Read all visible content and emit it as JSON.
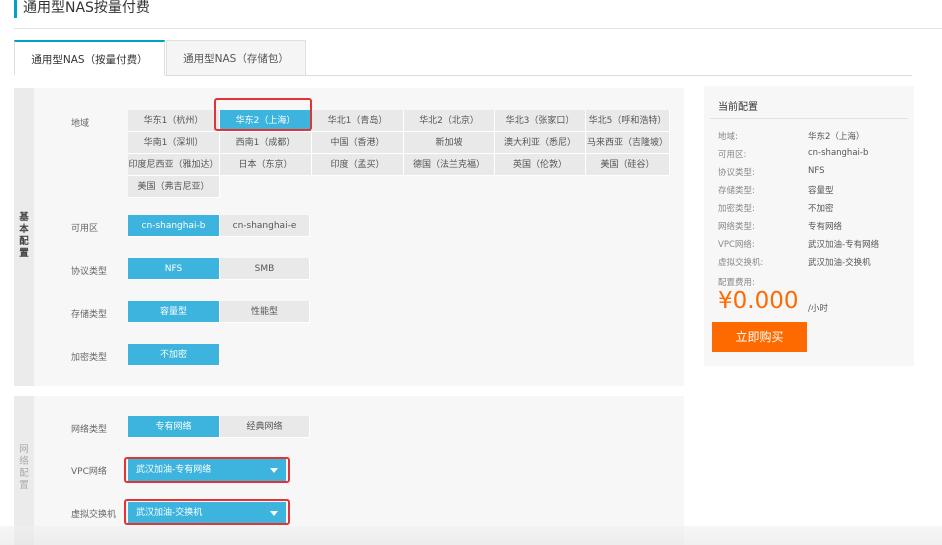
{
  "header": {
    "title": "通用型NAS按量付费"
  },
  "tabs": [
    {
      "label": "通用型NAS（按量付费）",
      "active": true
    },
    {
      "label": "通用型NAS（存储包）",
      "active": false
    }
  ],
  "basic_section": {
    "side_label": [
      "基",
      "本",
      "配",
      "置"
    ],
    "region": {
      "label": "地域",
      "selected": "华东2（上海）",
      "options": [
        "华东1（杭州）",
        "华东2（上海）",
        "华北1（青岛）",
        "华北2（北京）",
        "华北3（张家口）",
        "华北5（呼和浩特）",
        "华南1（深圳）",
        "西南1（成都）",
        "中国（香港）",
        "新加坡",
        "澳大利亚（悉尼）",
        "马来西亚（吉隆坡）",
        "印度尼西亚（雅加达）",
        "日本（东京）",
        "印度（孟买）",
        "德国（法兰克福）",
        "英国（伦敦）",
        "美国（硅谷）",
        "美国（弗吉尼亚）"
      ]
    },
    "zone": {
      "label": "可用区",
      "options": [
        "cn-shanghai-b",
        "cn-shanghai-e"
      ],
      "selected": "cn-shanghai-b"
    },
    "protocol": {
      "label": "协议类型",
      "options": [
        "NFS",
        "SMB"
      ],
      "selected": "NFS"
    },
    "storage": {
      "label": "存储类型",
      "options": [
        "容量型",
        "性能型"
      ],
      "selected": "容量型"
    },
    "encryption": {
      "label": "加密类型",
      "options": [
        "不加密"
      ],
      "selected": "不加密"
    }
  },
  "network_section": {
    "side_label": [
      "网",
      "络",
      "配",
      "置"
    ],
    "network_type": {
      "label": "网络类型",
      "options": [
        "专有网络",
        "经典网络"
      ],
      "selected": "专有网络"
    },
    "vpc": {
      "label": "VPC网络",
      "value": "武汉加油-专有网络"
    },
    "vswitch": {
      "label": "虚拟交换机",
      "value": "武汉加油-交换机"
    }
  },
  "summary": {
    "title": "当前配置",
    "items": [
      {
        "label": "地域:",
        "value": "华东2（上海）"
      },
      {
        "label": "可用区:",
        "value": "cn-shanghai-b"
      },
      {
        "label": "协议类型:",
        "value": "NFS"
      },
      {
        "label": "存储类型:",
        "value": "容量型"
      },
      {
        "label": "加密类型:",
        "value": "不加密"
      },
      {
        "label": "网络类型:",
        "value": "专有网络"
      },
      {
        "label": "VPC网络:",
        "value": "武汉加油-专有网络"
      },
      {
        "label": "虚拟交换机:",
        "value": "武汉加油-交换机"
      }
    ],
    "fee_label": "配置费用:",
    "price": "¥0.000",
    "price_unit": "/小时",
    "buy_label": "立即购买"
  },
  "colors": {
    "accent": "#3cb4de",
    "brand_orange": "#ff6a00",
    "highlight": "#e23434",
    "title_bar": "#00a2ca"
  }
}
